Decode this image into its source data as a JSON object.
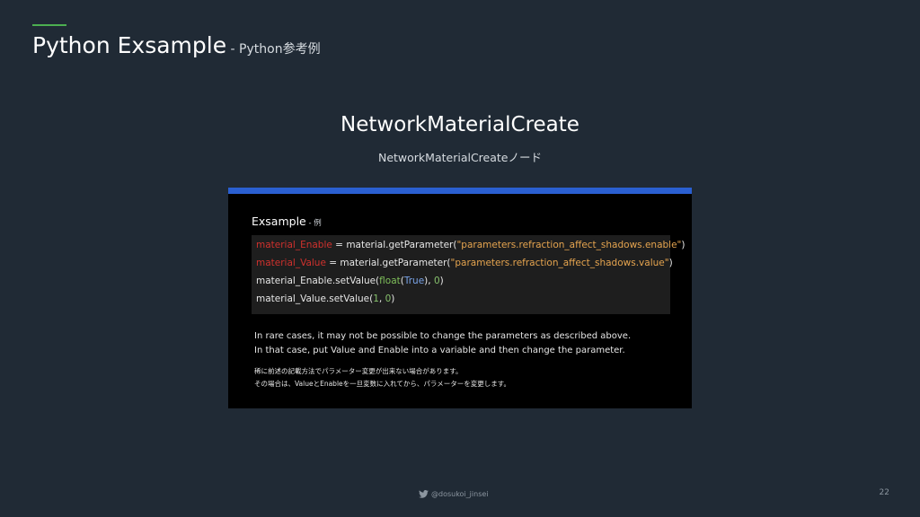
{
  "slide": {
    "title_main": "Python Exsample",
    "title_sub": " - Python参考例",
    "heading": "NetworkMaterialCreate",
    "subheading": "NetworkMaterialCreateノード",
    "accent_color": "#4caf50",
    "panel_bar_color": "#2a5fd1"
  },
  "panel": {
    "label_main": "Exsample",
    "label_sub": " - 例",
    "code": {
      "line1": {
        "var": "material_Enable",
        "op": " = material.getParameter(",
        "str": "\"parameters.refraction_affect_shadows.enable\"",
        "end": ")"
      },
      "line2": {
        "var": "material_Value",
        "op": " = material.getParameter(",
        "str": "\"parameters.refraction_affect_shadows.value\"",
        "end": ")"
      },
      "line3": {
        "start": "material_Enable.setValue(",
        "fn": "float",
        "open": "(",
        "kw": "True",
        "mid": "), ",
        "num": "0",
        "end": ")"
      },
      "line4": {
        "start": "material_Value.setValue(",
        "num1": "1",
        "sep": ", ",
        "num2": "0",
        "end": ")"
      }
    },
    "text_en_1": "In rare cases, it may not be possible to change the parameters as described above.",
    "text_en_2": "In that case, put Value and Enable into a variable and then change the parameter.",
    "text_jp_1": "稀に前述の記載方法でパラメーター変更が出来ない場合があります。",
    "text_jp_2": "その場合は、ValueとEnableを一旦変数に入れてから、パラメーターを変更します。"
  },
  "footer": {
    "icon": "twitter-bird-icon",
    "handle": "@dosukoi_jinsei",
    "page_number": "22"
  }
}
